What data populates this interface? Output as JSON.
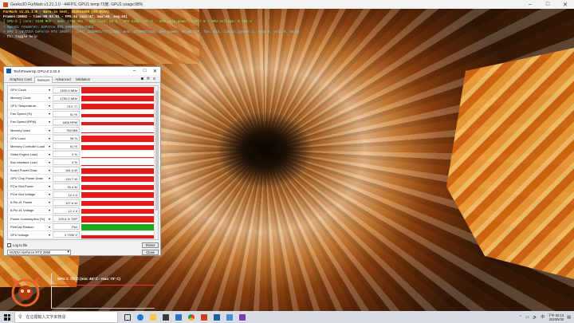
{
  "furmark": {
    "title": "Geeks3D FurMark v1.21.1.0 - 44FPS, GPU1 temp:73度, GPU1 usage:98%",
    "overlay": [
      "FurMark v1.21.1.0 - Burn-in test, 1920x1080 (8X MSAA)",
      "Frames:16652 - time:00:03:51 - FPS:44 (min:47, max:46, avg:44)",
      "[ GPU-Z ] core: 1530 MHz - mem: 1750 MHz - GPU load: 98 % - GPU temp: 73 °C - GPU chip power: 119.7 W - GPU Voltage: 0.793 V",
      "> OpenGL renderer: GeForce RTX 2060/PCIe/SSE2",
      "> GPU 1 (NVIDIA GeForce RTX 2060) - core: 1530MHz/73°C/98%, mem: 1750MHz/62%, GPU power: 88.0% TDP, fan: 51%, limits:[power:1, temp:0, volt:0, OV:0]",
      "- F1: toggle help"
    ]
  },
  "gpuz": {
    "title": "TechPowerUp GPU-Z 2.32.0",
    "tabs": [
      "Graphics Card",
      "Sensors",
      "Advanced",
      "Validation"
    ],
    "active_tab": "Sensors",
    "sensors": [
      {
        "label": "GPU Clock",
        "value": "1530.0 MHz",
        "level": 0.95,
        "color": "#e31b1b"
      },
      {
        "label": "Memory Clock",
        "value": "1750.2 MHz",
        "level": 0.95,
        "color": "#e31b1b"
      },
      {
        "label": "GPU Temperature",
        "value": "73.0 °C",
        "level": 0.9,
        "color": "#e31b1b"
      },
      {
        "label": "Fan Speed (%)",
        "value": "51 %",
        "level": 0.55,
        "color": "#e31b1b"
      },
      {
        "label": "Fan Speed (RPM)",
        "value": "1806 RPM",
        "level": 0.55,
        "color": "#e31b1b"
      },
      {
        "label": "Memory Used",
        "value": "750 MB",
        "level": 0.15,
        "color": "#e31b1b"
      },
      {
        "label": "GPU Load",
        "value": "98 %",
        "level": 0.95,
        "color": "#e31b1b"
      },
      {
        "label": "Memory Controller Load",
        "value": "61 %",
        "level": 0.7,
        "color": "#e31b1b"
      },
      {
        "label": "Video Engine Load",
        "value": "0 %",
        "level": 0.0,
        "color": "#e31b1b"
      },
      {
        "label": "Bus Interface Load",
        "value": "0 %",
        "level": 0.0,
        "color": "#e31b1b"
      },
      {
        "label": "Board Power Draw",
        "value": "161.0 W",
        "level": 0.9,
        "color": "#e31b1b"
      },
      {
        "label": "GPU Chip Power Draw",
        "value": "119.7 W",
        "level": 0.85,
        "color": "#e31b1b"
      },
      {
        "label": "PCIe Slot Power",
        "value": "33.4 W",
        "level": 0.8,
        "color": "#e31b1b"
      },
      {
        "label": "PCIe Slot Voltage",
        "value": "12.1 V",
        "level": 0.85,
        "color": "#e31b1b"
      },
      {
        "label": "8-Pin #1 Power",
        "value": "127.6 W",
        "level": 0.85,
        "color": "#e31b1b"
      },
      {
        "label": "8-Pin #1 Voltage",
        "value": "12.1 V",
        "level": 0.85,
        "color": "#e31b1b"
      },
      {
        "label": "Power Consumption (%)",
        "value": "100.6 % TDP",
        "level": 0.9,
        "color": "#e31b1b"
      },
      {
        "label": "PerfCap Reason",
        "value": "Pwr",
        "level": 1.0,
        "color": "#21a821"
      },
      {
        "label": "GPU Voltage",
        "value": "0.7930 V",
        "level": 0.5,
        "color": "#e31b1b"
      }
    ],
    "log_label": "Log to file",
    "reset_label": "Reset",
    "gpu_select": "NVIDIA GeForce RTX 2060",
    "close_label": "Close"
  },
  "temp_graph": {
    "label": "GPU 1: 73° C (min: 46° C - max: 73° C)",
    "level": 0.73
  },
  "taskbar": {
    "search_placeholder": "在這裡輸入文字來搜尋",
    "time": "下午 02:13",
    "date": "2020/5/30",
    "apps": [
      "task-view",
      "edge",
      "file-explorer",
      "store",
      "mail",
      "chrome",
      "furmark",
      "gpuz",
      "photos",
      "media"
    ]
  }
}
